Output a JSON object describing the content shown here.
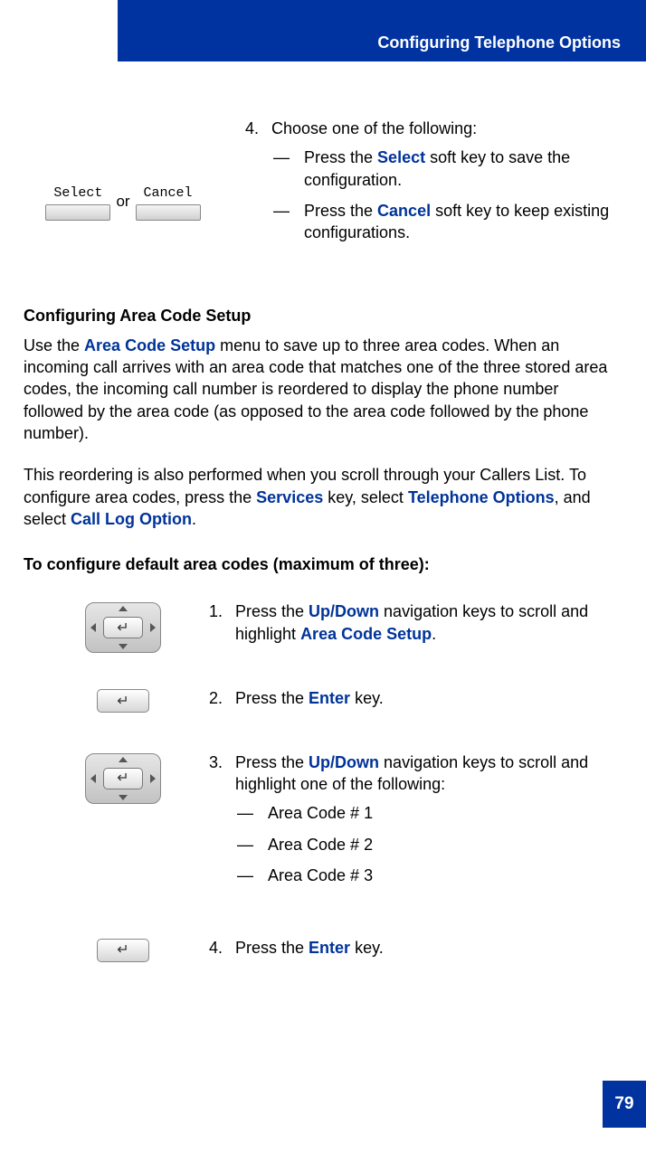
{
  "header": {
    "title": "Configuring Telephone Options"
  },
  "step4": {
    "softkey_left": "Select",
    "softkey_right": "Cancel",
    "or": "or",
    "marker": "4.",
    "intro": "Choose one of the following:",
    "optA_pre": "Press the ",
    "optA_key": "Select",
    "optA_post": " soft key to save the configuration.",
    "optB_pre": "Press the ",
    "optB_key": "Cancel",
    "optB_post": " soft key to keep existing configurations."
  },
  "section": {
    "heading": "Configuring Area Code Setup",
    "para1_pre": "Use the ",
    "para1_link": "Area Code Setup",
    "para1_post": " menu to save up to three area codes. When an incoming call arrives with an area code that matches one of the three stored area codes, the incoming call number is reordered to display the phone number followed by the area code (as opposed to the area code followed by the phone number).",
    "para2_pre": "This reordering is also performed when you scroll through your Callers List. To configure area codes, press the ",
    "para2_k1": "Services",
    "para2_mid1": " key, select ",
    "para2_k2": "Telephone Options",
    "para2_mid2": ", and select ",
    "para2_k3": "Call Log Option",
    "para2_end": ".",
    "subheading": "To configure default area codes (maximum of three):"
  },
  "steps": {
    "s1": {
      "marker": "1.",
      "pre": "Press the ",
      "k1": "Up/Down",
      "mid": " navigation keys to scroll and highlight ",
      "k2": "Area Code Setup",
      "end": "."
    },
    "s2": {
      "marker": "2.",
      "pre": "Press the ",
      "k1": "Enter",
      "post": " key."
    },
    "s3": {
      "marker": "3.",
      "pre": "Press the ",
      "k1": "Up/Down",
      "post": " navigation keys to scroll and highlight one of the following:",
      "opt1": "Area Code # 1",
      "opt2": "Area Code # 2",
      "opt3": "Area Code # 3"
    },
    "s4": {
      "marker": "4.",
      "pre": "Press the ",
      "k1": "Enter",
      "post": " key."
    }
  },
  "dash": "—",
  "page_number": "79"
}
